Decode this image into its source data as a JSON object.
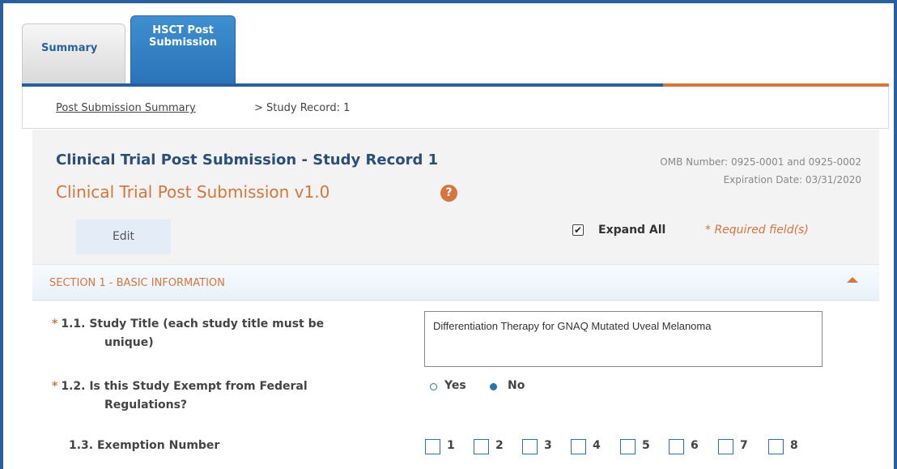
{
  "tabs": [
    {
      "label": "Summary",
      "active": false
    },
    {
      "label": "HSCT Post\nSubmission",
      "active": true
    }
  ],
  "breadcrumb": {
    "link": "Post Submission Summary",
    "current": "> Study Record: 1"
  },
  "header": {
    "title": "Clinical Trial Post Submission - Study Record 1",
    "subtitle": "Clinical Trial Post Submission v1.0",
    "help_icon": "question-circle-icon",
    "omb_number": "OMB Number: 0925-0001 and 0925-0002",
    "expiration": "Expiration Date: 03/31/2020"
  },
  "toolbar": {
    "edit_label": "Edit",
    "expand_all_label": "Expand All",
    "expand_all_checked": true,
    "required_note": "* Required field(s)"
  },
  "section": {
    "title": "SECTION 1 - BASIC INFORMATION",
    "collapse_icon": "caret-up-icon"
  },
  "questions": {
    "q1": {
      "star": "*",
      "label_line1": "1.1. Study Title (each study title must be",
      "label_line2": "unique)",
      "value": "Differentiation Therapy for GNAQ Mutated Uveal Melanoma"
    },
    "q2": {
      "star": "*",
      "label_line1": "1.2. Is this Study Exempt from Federal",
      "label_line2": "Regulations?",
      "options": [
        "Yes",
        "No"
      ],
      "selected": "No"
    },
    "q3": {
      "label": "1.3. Exemption Number",
      "options": [
        "1",
        "2",
        "3",
        "4",
        "5",
        "6",
        "7",
        "8"
      ]
    }
  },
  "colors": {
    "brand_blue": "#2a5f9e",
    "accent_orange": "#d6763c",
    "radio_blue": "#2a72b8"
  }
}
